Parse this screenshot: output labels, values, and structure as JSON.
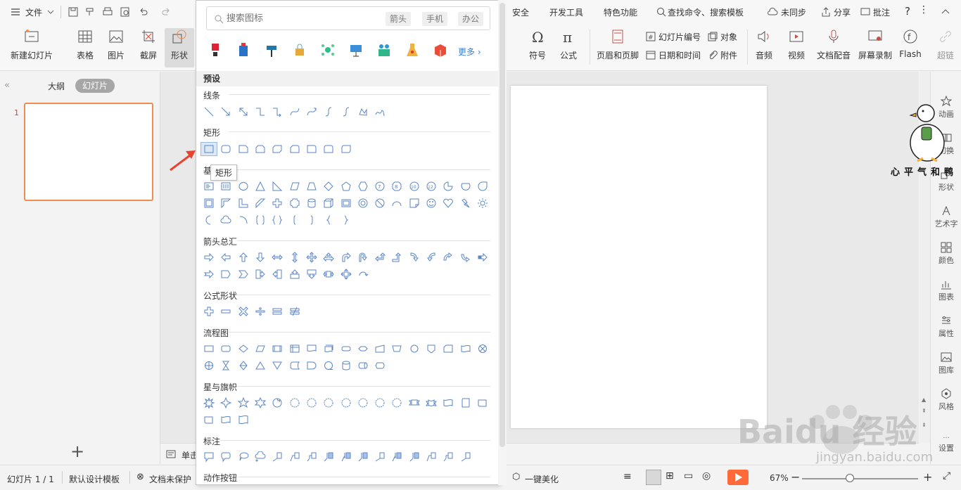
{
  "menubar": {
    "file_label": "文件",
    "security": "安全",
    "developer": "开发工具",
    "special": "特色功能",
    "search_cmd": "查找命令、搜索模板",
    "sync": "未同步",
    "share": "分享",
    "comment": "批注"
  },
  "ribbon": {
    "new_slide": "新建幻灯片",
    "table": "表格",
    "picture": "图片",
    "screenshot": "截屏",
    "shape": "形状",
    "symbol": "符号",
    "formula": "公式",
    "header_footer": "页眉和页脚",
    "slide_number": "幻灯片编号",
    "object": "对象",
    "date_time": "日期和时间",
    "attachment": "附件",
    "audio": "音频",
    "video": "视频",
    "doc_audio": "文档配音",
    "screen_record": "屏幕录制",
    "flash": "Flash",
    "hyperlink_partial": "超链"
  },
  "leftpanel": {
    "tab_outline": "大纲",
    "tab_slides": "幻灯片",
    "slide_number": "1",
    "add_slide": "+"
  },
  "notes": {
    "label": "单击"
  },
  "rightbar": {
    "animation": "动画",
    "transition": "切换",
    "shape": "形状",
    "art_text": "艺术字",
    "color": "颜色",
    "chart": "图表",
    "property": "属性",
    "gallery": "图库",
    "style": "风格",
    "settings": "设置"
  },
  "statusbar": {
    "slide_count": "幻灯片 1 / 1",
    "template": "默认设计模板",
    "protect": "文档未保护",
    "beautify": "一键美化",
    "zoom": "67%",
    "zoom_fraction": 0.38
  },
  "shapes_panel": {
    "search_placeholder": "搜索图标",
    "tags": [
      "箭头",
      "手机",
      "办公"
    ],
    "more": "更多",
    "preset": "预设",
    "sections": {
      "lines": "线条",
      "rect": "矩形",
      "basic": "基",
      "arrows": "箭头总汇",
      "formula": "公式形状",
      "flow": "流程图",
      "stars": "星与旗帜",
      "callouts": "标注",
      "actions": "动作按钮"
    },
    "tooltip": "矩形"
  },
  "decor": {
    "duck_caption": "心平气和鸭",
    "watermark": "Baidu 经验",
    "watermark_url": "jingyan.baidu.com"
  },
  "colors": {
    "accent_orange": "#f08c50",
    "shape_blue": "#5b86c5",
    "red_arrow": "#e8432f",
    "play_orange": "#ff6a3a"
  }
}
